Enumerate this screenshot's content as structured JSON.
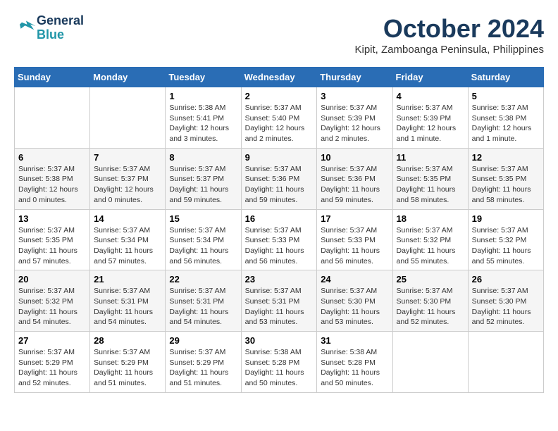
{
  "header": {
    "logo_line1": "General",
    "logo_line2": "Blue",
    "month_year": "October 2024",
    "location": "Kipit, Zamboanga Peninsula, Philippines"
  },
  "weekdays": [
    "Sunday",
    "Monday",
    "Tuesday",
    "Wednesday",
    "Thursday",
    "Friday",
    "Saturday"
  ],
  "weeks": [
    [
      {
        "day": "",
        "info": ""
      },
      {
        "day": "",
        "info": ""
      },
      {
        "day": "1",
        "info": "Sunrise: 5:38 AM\nSunset: 5:41 PM\nDaylight: 12 hours and 3 minutes."
      },
      {
        "day": "2",
        "info": "Sunrise: 5:37 AM\nSunset: 5:40 PM\nDaylight: 12 hours and 2 minutes."
      },
      {
        "day": "3",
        "info": "Sunrise: 5:37 AM\nSunset: 5:39 PM\nDaylight: 12 hours and 2 minutes."
      },
      {
        "day": "4",
        "info": "Sunrise: 5:37 AM\nSunset: 5:39 PM\nDaylight: 12 hours and 1 minute."
      },
      {
        "day": "5",
        "info": "Sunrise: 5:37 AM\nSunset: 5:38 PM\nDaylight: 12 hours and 1 minute."
      }
    ],
    [
      {
        "day": "6",
        "info": "Sunrise: 5:37 AM\nSunset: 5:38 PM\nDaylight: 12 hours and 0 minutes."
      },
      {
        "day": "7",
        "info": "Sunrise: 5:37 AM\nSunset: 5:37 PM\nDaylight: 12 hours and 0 minutes."
      },
      {
        "day": "8",
        "info": "Sunrise: 5:37 AM\nSunset: 5:37 PM\nDaylight: 11 hours and 59 minutes."
      },
      {
        "day": "9",
        "info": "Sunrise: 5:37 AM\nSunset: 5:36 PM\nDaylight: 11 hours and 59 minutes."
      },
      {
        "day": "10",
        "info": "Sunrise: 5:37 AM\nSunset: 5:36 PM\nDaylight: 11 hours and 59 minutes."
      },
      {
        "day": "11",
        "info": "Sunrise: 5:37 AM\nSunset: 5:35 PM\nDaylight: 11 hours and 58 minutes."
      },
      {
        "day": "12",
        "info": "Sunrise: 5:37 AM\nSunset: 5:35 PM\nDaylight: 11 hours and 58 minutes."
      }
    ],
    [
      {
        "day": "13",
        "info": "Sunrise: 5:37 AM\nSunset: 5:35 PM\nDaylight: 11 hours and 57 minutes."
      },
      {
        "day": "14",
        "info": "Sunrise: 5:37 AM\nSunset: 5:34 PM\nDaylight: 11 hours and 57 minutes."
      },
      {
        "day": "15",
        "info": "Sunrise: 5:37 AM\nSunset: 5:34 PM\nDaylight: 11 hours and 56 minutes."
      },
      {
        "day": "16",
        "info": "Sunrise: 5:37 AM\nSunset: 5:33 PM\nDaylight: 11 hours and 56 minutes."
      },
      {
        "day": "17",
        "info": "Sunrise: 5:37 AM\nSunset: 5:33 PM\nDaylight: 11 hours and 56 minutes."
      },
      {
        "day": "18",
        "info": "Sunrise: 5:37 AM\nSunset: 5:32 PM\nDaylight: 11 hours and 55 minutes."
      },
      {
        "day": "19",
        "info": "Sunrise: 5:37 AM\nSunset: 5:32 PM\nDaylight: 11 hours and 55 minutes."
      }
    ],
    [
      {
        "day": "20",
        "info": "Sunrise: 5:37 AM\nSunset: 5:32 PM\nDaylight: 11 hours and 54 minutes."
      },
      {
        "day": "21",
        "info": "Sunrise: 5:37 AM\nSunset: 5:31 PM\nDaylight: 11 hours and 54 minutes."
      },
      {
        "day": "22",
        "info": "Sunrise: 5:37 AM\nSunset: 5:31 PM\nDaylight: 11 hours and 54 minutes."
      },
      {
        "day": "23",
        "info": "Sunrise: 5:37 AM\nSunset: 5:31 PM\nDaylight: 11 hours and 53 minutes."
      },
      {
        "day": "24",
        "info": "Sunrise: 5:37 AM\nSunset: 5:30 PM\nDaylight: 11 hours and 53 minutes."
      },
      {
        "day": "25",
        "info": "Sunrise: 5:37 AM\nSunset: 5:30 PM\nDaylight: 11 hours and 52 minutes."
      },
      {
        "day": "26",
        "info": "Sunrise: 5:37 AM\nSunset: 5:30 PM\nDaylight: 11 hours and 52 minutes."
      }
    ],
    [
      {
        "day": "27",
        "info": "Sunrise: 5:37 AM\nSunset: 5:29 PM\nDaylight: 11 hours and 52 minutes."
      },
      {
        "day": "28",
        "info": "Sunrise: 5:37 AM\nSunset: 5:29 PM\nDaylight: 11 hours and 51 minutes."
      },
      {
        "day": "29",
        "info": "Sunrise: 5:37 AM\nSunset: 5:29 PM\nDaylight: 11 hours and 51 minutes."
      },
      {
        "day": "30",
        "info": "Sunrise: 5:38 AM\nSunset: 5:28 PM\nDaylight: 11 hours and 50 minutes."
      },
      {
        "day": "31",
        "info": "Sunrise: 5:38 AM\nSunset: 5:28 PM\nDaylight: 11 hours and 50 minutes."
      },
      {
        "day": "",
        "info": ""
      },
      {
        "day": "",
        "info": ""
      }
    ]
  ]
}
